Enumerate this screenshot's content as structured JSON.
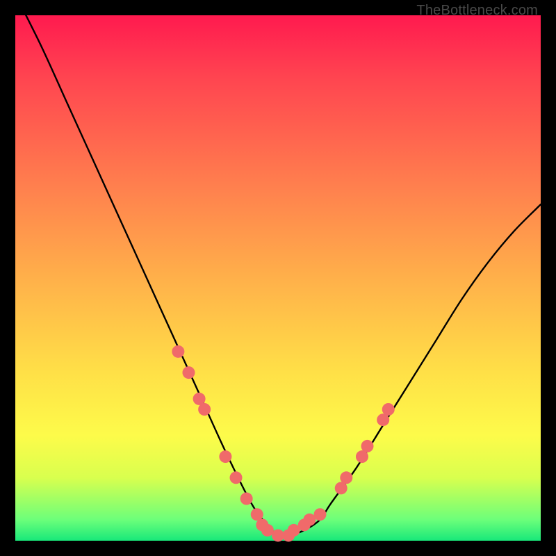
{
  "attribution": "TheBottleneck.com",
  "chart_data": {
    "type": "line",
    "title": "",
    "xlabel": "",
    "ylabel": "",
    "xlim": [
      0,
      100
    ],
    "ylim": [
      0,
      100
    ],
    "series": [
      {
        "name": "bottleneck-curve",
        "x": [
          0,
          5,
          10,
          15,
          20,
          25,
          30,
          35,
          40,
          45,
          48,
          50,
          52,
          55,
          58,
          60,
          65,
          70,
          75,
          80,
          85,
          90,
          95,
          100
        ],
        "y": [
          104,
          94,
          83,
          72,
          61,
          50,
          39,
          28,
          17,
          7,
          3,
          1,
          1,
          2,
          4,
          7,
          14,
          22,
          30,
          38,
          46,
          53,
          59,
          64
        ]
      }
    ],
    "markers": {
      "name": "highlight-dots",
      "color": "#f06a6a",
      "points": [
        {
          "x": 31,
          "y": 36
        },
        {
          "x": 33,
          "y": 32
        },
        {
          "x": 35,
          "y": 27
        },
        {
          "x": 36,
          "y": 25
        },
        {
          "x": 40,
          "y": 16
        },
        {
          "x": 42,
          "y": 12
        },
        {
          "x": 44,
          "y": 8
        },
        {
          "x": 46,
          "y": 5
        },
        {
          "x": 47,
          "y": 3
        },
        {
          "x": 48,
          "y": 2
        },
        {
          "x": 50,
          "y": 1
        },
        {
          "x": 52,
          "y": 1
        },
        {
          "x": 53,
          "y": 2
        },
        {
          "x": 55,
          "y": 3
        },
        {
          "x": 56,
          "y": 4
        },
        {
          "x": 58,
          "y": 5
        },
        {
          "x": 62,
          "y": 10
        },
        {
          "x": 63,
          "y": 12
        },
        {
          "x": 66,
          "y": 16
        },
        {
          "x": 67,
          "y": 18
        },
        {
          "x": 70,
          "y": 23
        },
        {
          "x": 71,
          "y": 25
        }
      ]
    }
  }
}
